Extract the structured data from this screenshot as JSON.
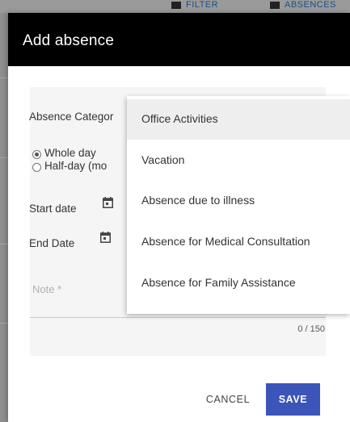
{
  "background": {
    "filter_label": "FILTER",
    "absences_label": "ABSENCES"
  },
  "dialog": {
    "title": "Add absence",
    "absence_category_label": "Absence Categor",
    "radio_whole_day": "Whole day",
    "radio_half_day": "Half-day (mo",
    "start_date_label": "Start date",
    "end_date_label": "End Date",
    "note_placeholder": "Note *",
    "note_counter": "0 / 150",
    "cancel_label": "CANCEL",
    "save_label": "SAVE"
  },
  "category_options": [
    "Office Activities",
    "Vacation",
    "Absence due to illness",
    "Absence for Medical Consultation",
    "Absence for Family Assistance"
  ],
  "colors": {
    "header": "#000000",
    "save_button": "#3b55b8",
    "overlay": "#8f8f8f"
  }
}
